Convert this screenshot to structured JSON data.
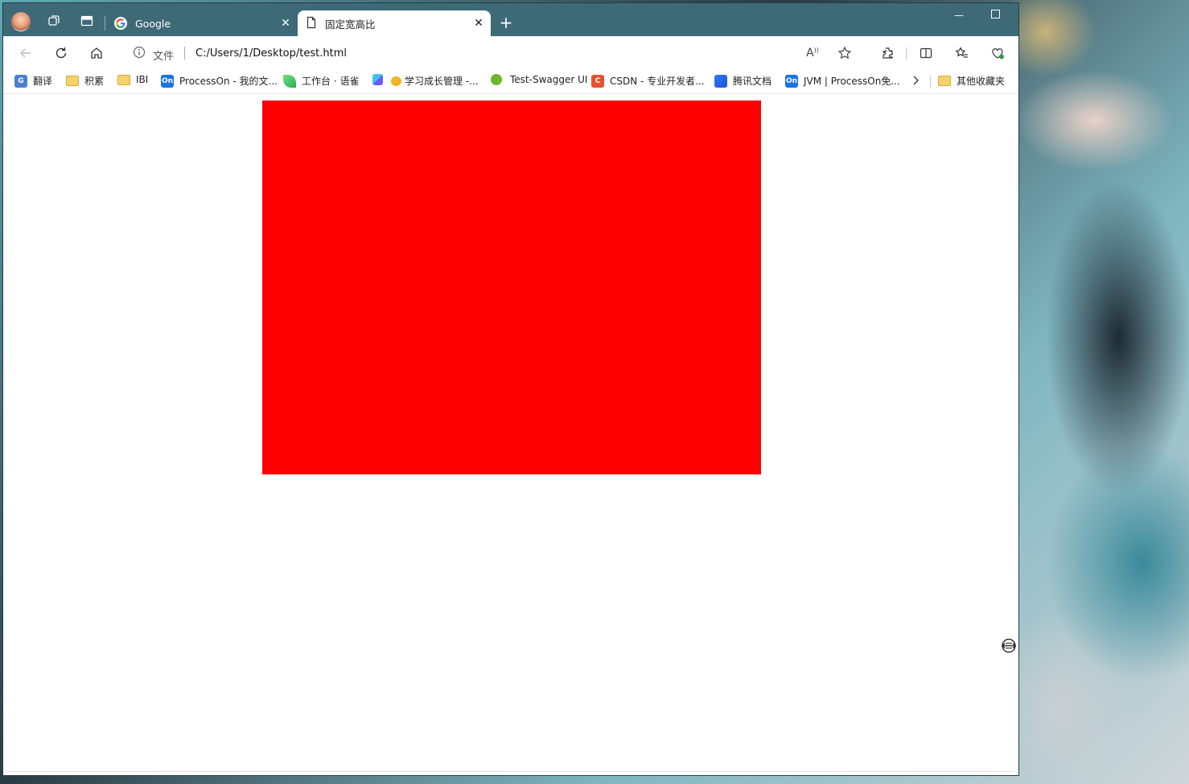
{
  "window": {
    "tabs": [
      {
        "label": "Google",
        "close": "✕"
      },
      {
        "label": "固定宽高比",
        "close": "✕"
      }
    ],
    "new_tab": "+",
    "minimize": "—"
  },
  "toolbar": {
    "file_label": "文件",
    "url": "C:/Users/1/Desktop/test.html",
    "read_aloud": "A"
  },
  "bookmarks": [
    {
      "label": "翻译",
      "icon": "translate-icon"
    },
    {
      "label": "积累",
      "icon": "folder-icon"
    },
    {
      "label": "IBI",
      "icon": "folder-icon"
    },
    {
      "label": "ProcessOn - 我的文...",
      "icon": "processon-icon",
      "badge": "On"
    },
    {
      "label": "工作台 · 语雀",
      "icon": "yuque-icon"
    },
    {
      "label": "",
      "icon": "app-icon"
    },
    {
      "label": "学习成长管理 -...",
      "icon": "learning-icon"
    },
    {
      "label": "Test-Swagger UI",
      "icon": "swagger-icon"
    },
    {
      "label": "CSDN - 专业开发者...",
      "icon": "csdn-icon",
      "badge": "C"
    },
    {
      "label": "腾讯文档",
      "icon": "tencent-docs-icon"
    },
    {
      "label": "JVM | ProcessOn免...",
      "icon": "processon-icon",
      "badge": "On"
    }
  ],
  "other_bookmarks": "其他收藏夹",
  "content": {
    "box_color": "#ff0000"
  },
  "colors": {
    "titlebar": "#3e6a78",
    "accent_blue": "#1a73e8"
  }
}
